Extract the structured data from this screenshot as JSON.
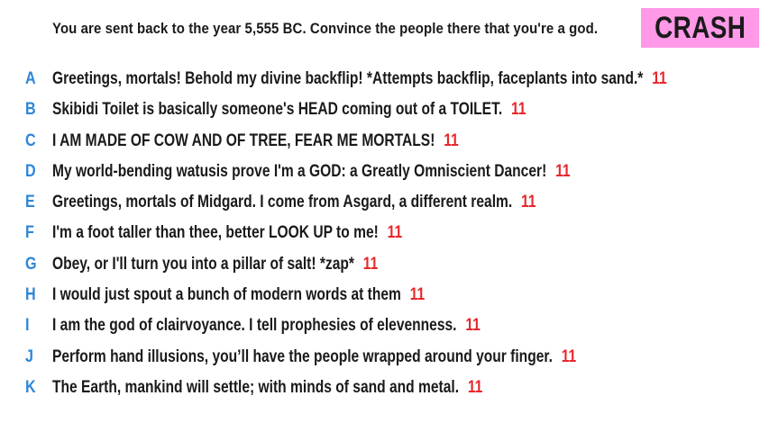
{
  "prompt": "You are sent back to the year 5,555 BC. Convince the people there that you're a god.",
  "badge": "CRASH",
  "colors": {
    "letter": "#2e86d8",
    "score": "#e8262a",
    "badge_bg": "#ff99e8",
    "text": "#1a1a1a"
  },
  "answers": [
    {
      "letter": "A",
      "text": "Greetings, mortals! Behold my divine backflip! *Attempts backflip, faceplants into sand.*",
      "score": "11"
    },
    {
      "letter": "B",
      "text": "Skibidi Toilet is basically someone's HEAD coming out of a TOILET.",
      "score": "11"
    },
    {
      "letter": "C",
      "text": "I AM MADE OF COW AND OF TREE, FEAR ME MORTALS!",
      "score": "11"
    },
    {
      "letter": "D",
      "text": "My world-bending watusis prove I'm a GOD: a Greatly Omniscient Dancer!",
      "score": "11"
    },
    {
      "letter": "E",
      "text": "Greetings, mortals of Midgard. I come from Asgard, a different realm.",
      "score": "11"
    },
    {
      "letter": "F",
      "text": "I'm a foot taller than thee, better LOOK UP to me!",
      "score": "11"
    },
    {
      "letter": "G",
      "text": "Obey, or I'll turn you into a pillar of salt! *zap*",
      "score": "11"
    },
    {
      "letter": "H",
      "text": "I would just spout a bunch of modern words at them",
      "score": "11"
    },
    {
      "letter": "I",
      "text": "I am the god of clairvoyance. I tell prophesies of elevenness.",
      "score": "11"
    },
    {
      "letter": "J",
      "text": "Perform hand illusions, you’ll have the people wrapped around your finger.",
      "score": "11"
    },
    {
      "letter": "K",
      "text": "The Earth, mankind will settle; with minds of sand and metal.",
      "score": "11"
    }
  ]
}
